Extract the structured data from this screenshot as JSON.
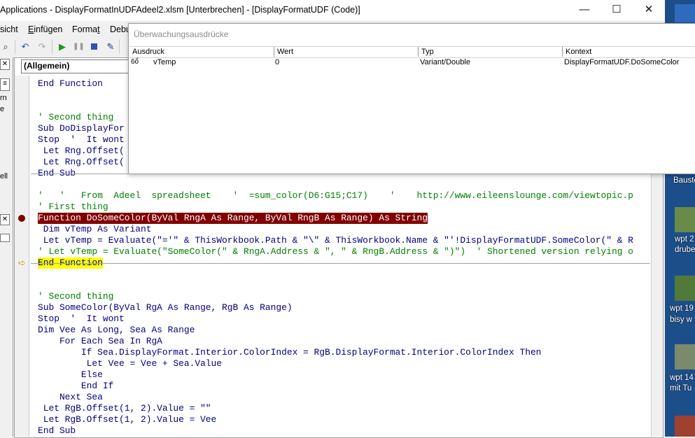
{
  "window": {
    "title": "Applications - DisplayFormatInUDFAdeel2.xlsm [Unterbrechen] - [DisplayFormatUDF (Code)]",
    "minimize": "—",
    "maximize": "☐",
    "close": "✕"
  },
  "menu": {
    "ansicht": "sicht",
    "einfuegen_pre": "",
    "einfuegen_u": "E",
    "einfuegen_post": "infügen",
    "format_pre": "Forma",
    "format_u": "t",
    "debug": "Debu"
  },
  "left_panel": {
    "rn": "rn",
    "e": "e",
    "ell": "ell"
  },
  "code_window": {
    "object_combo": "(Allgemein)",
    "lines": [
      {
        "text": "End Function",
        "color": "#000080"
      },
      {
        "text": "",
        "color": "#000000"
      },
      {
        "text": "",
        "color": "#000000"
      },
      {
        "text": "' Second thing",
        "color": "#008000"
      },
      {
        "text": "Sub DoDisplayFor",
        "color": "#000080"
      },
      {
        "text": "Stop  '  It wont",
        "color": "#000080"
      },
      {
        "text": " Let Rng.Offset(",
        "color": "#000080"
      },
      {
        "text": " Let Rng.Offset(",
        "color": "#000080"
      },
      {
        "text": "End Sub",
        "color": "#000080"
      },
      {
        "text": "",
        "color": "#000000"
      },
      {
        "text": "'   '   From  Adeel  spreadsheet    '  =sum_color(D6:G15;C17)    '    http://www.eileenslounge.com/viewtopic.p",
        "color": "#008000"
      },
      {
        "text": "' First thing",
        "color": "#008000"
      },
      {
        "text": "Function DoSomeColor(ByVal RngA As Range, ByVal RngB As Range) As String",
        "color": "#ffffff"
      },
      {
        "text": " Dim vTemp As Variant",
        "color": "#000080"
      },
      {
        "text": " Let vTemp = Evaluate(\"='\" & ThisWorkbook.Path & \"\\\" & ThisWorkbook.Name & \"'!DisplayFormatUDF.SomeColor(\" & R",
        "color": "#000080"
      },
      {
        "text": "' Let vTemp = Evaluate(\"SomeColor(\" & RngA.Address & \", \" & RngB.Address & \")\")  ' Shortened version relying o",
        "color": "#008000"
      },
      {
        "text": "End Function",
        "color": "#000080"
      },
      {
        "text": "",
        "color": "#000000"
      },
      {
        "text": "",
        "color": "#000000"
      },
      {
        "text": "' Second thing",
        "color": "#008000"
      },
      {
        "text": "Sub SomeColor(ByVal RgA As Range, RgB As Range)",
        "color": "#000080"
      },
      {
        "text": "Stop  '  It wont",
        "color": "#000080"
      },
      {
        "text": "Dim Vee As Long, Sea As Range",
        "color": "#000080"
      },
      {
        "text": "    For Each Sea In RgA",
        "color": "#000080"
      },
      {
        "text": "        If Sea.DisplayFormat.Interior.ColorIndex = RgB.DisplayFormat.Interior.ColorIndex Then",
        "color": "#000080"
      },
      {
        "text": "         Let Vee = Vee + Sea.Value",
        "color": "#000080"
      },
      {
        "text": "        Else",
        "color": "#000080"
      },
      {
        "text": "        End If",
        "color": "#000080"
      },
      {
        "text": "    Next Sea",
        "color": "#000080"
      },
      {
        "text": " Let RgB.Offset(1, 2).Value = \"\"",
        "color": "#000080"
      },
      {
        "text": " Let RgB.Offset(1, 2).Value = Vee",
        "color": "#000080"
      },
      {
        "text": "End Sub",
        "color": "#000080"
      }
    ]
  },
  "watch_window": {
    "title": "Überwachungsausdrücke",
    "columns": [
      "Ausdruck",
      "Wert",
      "Typ",
      "Kontext"
    ],
    "rows": [
      {
        "icon": "6ổ",
        "expression": "vTemp",
        "value": "0",
        "type": "Variant/Double",
        "context": "DisplayFormatUDF.DoSomeColor"
      }
    ]
  },
  "desktop": {
    "labels": [
      "Bauste",
      "wpt 2",
      "drube",
      "wpt 19",
      "bisy w",
      "wpt 14",
      "mit Tu"
    ]
  },
  "colors": {
    "breakpoint": "#800000",
    "current_line": "#ffff00",
    "keyword": "#000080",
    "comment": "#008000"
  }
}
